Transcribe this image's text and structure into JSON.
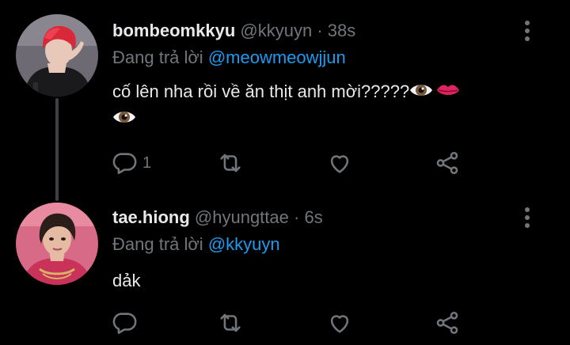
{
  "tweets": [
    {
      "display_name": "bombeomkkyu",
      "handle": "@kkyuyn",
      "separator": "·",
      "time": "38s",
      "reply_prefix": "Đang trả lời",
      "reply_to": "@meowmeowjjun",
      "text_line1": "cố lên nha rồi về ăn thịt anh mời?????",
      "emojis": [
        "eye-emoji",
        "lips-emoji",
        "eye-emoji"
      ],
      "reply_count": "1",
      "avatar_colors": {
        "hair": "#d8283a",
        "bg": "#6d6a74",
        "skin": "#e8c8b8",
        "coat": "#1a1a1c"
      }
    },
    {
      "display_name": "tae.hiong",
      "handle": "@hyungttae",
      "separator": "·",
      "time": "6s",
      "reply_prefix": "Đang trả lời",
      "reply_to": "@kkyuyn",
      "text": "dảk",
      "reply_count": "",
      "avatar_colors": {
        "hair": "#2b1d1a",
        "bg": "#d76a86",
        "skin": "#e6bba4",
        "shirt": "#c9335a"
      }
    }
  ],
  "colors": {
    "background": "#000000",
    "text": "#e7e9ea",
    "muted": "#71767b",
    "link": "#1d9bf0",
    "thread_line": "#3e4144"
  }
}
